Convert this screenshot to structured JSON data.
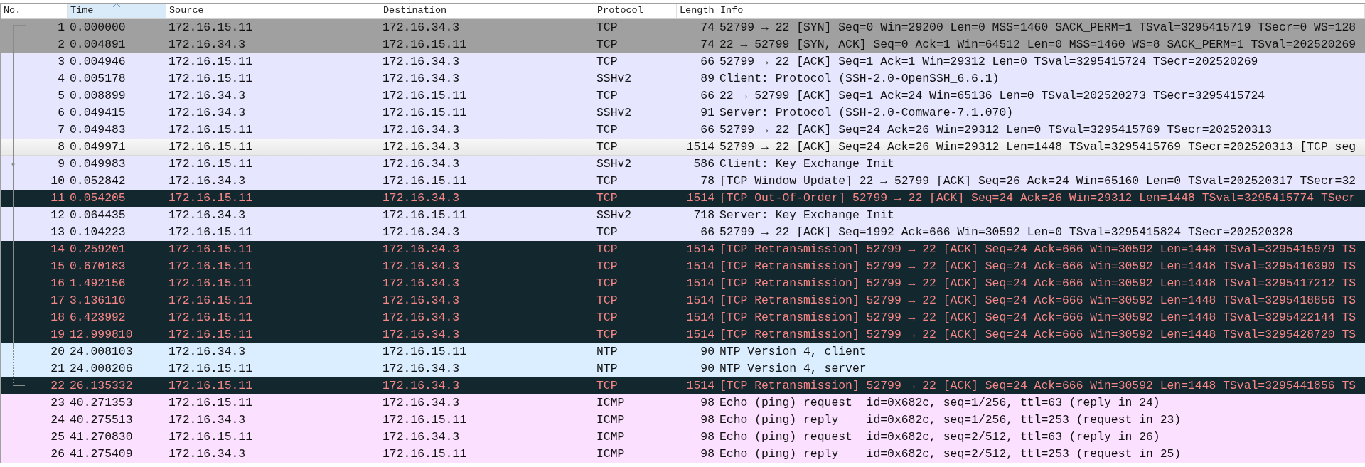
{
  "columns": [
    {
      "label": "No.",
      "sorted": false
    },
    {
      "label": "Time",
      "sorted": true
    },
    {
      "label": "Source",
      "sorted": false
    },
    {
      "label": "Destination",
      "sorted": false
    },
    {
      "label": "Protocol",
      "sorted": false
    },
    {
      "label": "Length",
      "sorted": false
    },
    {
      "label": "Info",
      "sorted": false
    }
  ],
  "rows": [
    {
      "no": "1",
      "time": "0.000000",
      "source": "172.16.15.11",
      "destination": "172.16.34.3",
      "protocol": "TCP",
      "length": "74",
      "info": "52799 → 22 [SYN] Seq=0 Win=29200 Len=0 MSS=1460 SACK_PERM=1 TSval=3295415719 TSecr=0 WS=128",
      "kind": "syn",
      "selected": false
    },
    {
      "no": "2",
      "time": "0.004891",
      "source": "172.16.34.3",
      "destination": "172.16.15.11",
      "protocol": "TCP",
      "length": "74",
      "info": "22 → 52799 [SYN, ACK] Seq=0 Ack=1 Win=64512 Len=0 MSS=1460 WS=8 SACK_PERM=1 TSval=202520269",
      "kind": "syn",
      "selected": false
    },
    {
      "no": "3",
      "time": "0.004946",
      "source": "172.16.15.11",
      "destination": "172.16.34.3",
      "protocol": "TCP",
      "length": "66",
      "info": "52799 → 22 [ACK] Seq=1 Ack=1 Win=29312 Len=0 TSval=3295415724 TSecr=202520269",
      "kind": "tcp",
      "selected": false
    },
    {
      "no": "4",
      "time": "0.005178",
      "source": "172.16.15.11",
      "destination": "172.16.34.3",
      "protocol": "SSHv2",
      "length": "89",
      "info": "Client: Protocol (SSH-2.0-OpenSSH_6.6.1)",
      "kind": "tcp",
      "selected": false
    },
    {
      "no": "5",
      "time": "0.008899",
      "source": "172.16.34.3",
      "destination": "172.16.15.11",
      "protocol": "TCP",
      "length": "66",
      "info": "22 → 52799 [ACK] Seq=1 Ack=24 Win=65136 Len=0 TSval=202520273 TSecr=3295415724",
      "kind": "tcp",
      "selected": false
    },
    {
      "no": "6",
      "time": "0.049415",
      "source": "172.16.34.3",
      "destination": "172.16.15.11",
      "protocol": "SSHv2",
      "length": "91",
      "info": "Server: Protocol (SSH-2.0-Comware-7.1.070)",
      "kind": "tcp",
      "selected": false
    },
    {
      "no": "7",
      "time": "0.049483",
      "source": "172.16.15.11",
      "destination": "172.16.34.3",
      "protocol": "TCP",
      "length": "66",
      "info": "52799 → 22 [ACK] Seq=24 Ack=26 Win=29312 Len=0 TSval=3295415769 TSecr=202520313",
      "kind": "tcp",
      "selected": false
    },
    {
      "no": "8",
      "time": "0.049971",
      "source": "172.16.15.11",
      "destination": "172.16.34.3",
      "protocol": "TCP",
      "length": "1514",
      "info": "52799 → 22 [ACK] Seq=24 Ack=26 Win=29312 Len=1448 TSval=3295415769 TSecr=202520313 [TCP seg",
      "kind": "tcp",
      "selected": true
    },
    {
      "no": "9",
      "time": "0.049983",
      "source": "172.16.15.11",
      "destination": "172.16.34.3",
      "protocol": "SSHv2",
      "length": "586",
      "info": "Client: Key Exchange Init",
      "kind": "tcp",
      "selected": false
    },
    {
      "no": "10",
      "time": "0.052842",
      "source": "172.16.34.3",
      "destination": "172.16.15.11",
      "protocol": "TCP",
      "length": "78",
      "info": "[TCP Window Update] 22 → 52799 [ACK] Seq=26 Ack=24 Win=65160 Len=0 TSval=202520317 TSecr=32",
      "kind": "tcp",
      "selected": false
    },
    {
      "no": "11",
      "time": "0.054205",
      "source": "172.16.15.11",
      "destination": "172.16.34.3",
      "protocol": "TCP",
      "length": "1514",
      "info": "[TCP Out-Of-Order] 52799 → 22 [ACK] Seq=24 Ack=26 Win=29312 Len=1448 TSval=3295415774 TSecr",
      "kind": "bad",
      "selected": false
    },
    {
      "no": "12",
      "time": "0.064435",
      "source": "172.16.34.3",
      "destination": "172.16.15.11",
      "protocol": "SSHv2",
      "length": "718",
      "info": "Server: Key Exchange Init",
      "kind": "tcp",
      "selected": false
    },
    {
      "no": "13",
      "time": "0.104223",
      "source": "172.16.15.11",
      "destination": "172.16.34.3",
      "protocol": "TCP",
      "length": "66",
      "info": "52799 → 22 [ACK] Seq=1992 Ack=666 Win=30592 Len=0 TSval=3295415824 TSecr=202520328",
      "kind": "tcp",
      "selected": false
    },
    {
      "no": "14",
      "time": "0.259201",
      "source": "172.16.15.11",
      "destination": "172.16.34.3",
      "protocol": "TCP",
      "length": "1514",
      "info": "[TCP Retransmission] 52799 → 22 [ACK] Seq=24 Ack=666 Win=30592 Len=1448 TSval=3295415979 TS",
      "kind": "bad",
      "selected": false
    },
    {
      "no": "15",
      "time": "0.670183",
      "source": "172.16.15.11",
      "destination": "172.16.34.3",
      "protocol": "TCP",
      "length": "1514",
      "info": "[TCP Retransmission] 52799 → 22 [ACK] Seq=24 Ack=666 Win=30592 Len=1448 TSval=3295416390 TS",
      "kind": "bad",
      "selected": false
    },
    {
      "no": "16",
      "time": "1.492156",
      "source": "172.16.15.11",
      "destination": "172.16.34.3",
      "protocol": "TCP",
      "length": "1514",
      "info": "[TCP Retransmission] 52799 → 22 [ACK] Seq=24 Ack=666 Win=30592 Len=1448 TSval=3295417212 TS",
      "kind": "bad",
      "selected": false
    },
    {
      "no": "17",
      "time": "3.136110",
      "source": "172.16.15.11",
      "destination": "172.16.34.3",
      "protocol": "TCP",
      "length": "1514",
      "info": "[TCP Retransmission] 52799 → 22 [ACK] Seq=24 Ack=666 Win=30592 Len=1448 TSval=3295418856 TS",
      "kind": "bad",
      "selected": false
    },
    {
      "no": "18",
      "time": "6.423992",
      "source": "172.16.15.11",
      "destination": "172.16.34.3",
      "protocol": "TCP",
      "length": "1514",
      "info": "[TCP Retransmission] 52799 → 22 [ACK] Seq=24 Ack=666 Win=30592 Len=1448 TSval=3295422144 TS",
      "kind": "bad",
      "selected": false
    },
    {
      "no": "19",
      "time": "12.999810",
      "source": "172.16.15.11",
      "destination": "172.16.34.3",
      "protocol": "TCP",
      "length": "1514",
      "info": "[TCP Retransmission] 52799 → 22 [ACK] Seq=24 Ack=666 Win=30592 Len=1448 TSval=3295428720 TS",
      "kind": "bad",
      "selected": false
    },
    {
      "no": "20",
      "time": "24.008103",
      "source": "172.16.34.3",
      "destination": "172.16.15.11",
      "protocol": "NTP",
      "length": "90",
      "info": "NTP Version 4, client",
      "kind": "udp",
      "selected": false
    },
    {
      "no": "21",
      "time": "24.008206",
      "source": "172.16.15.11",
      "destination": "172.16.34.3",
      "protocol": "NTP",
      "length": "90",
      "info": "NTP Version 4, server",
      "kind": "udp",
      "selected": false
    },
    {
      "no": "22",
      "time": "26.135332",
      "source": "172.16.15.11",
      "destination": "172.16.34.3",
      "protocol": "TCP",
      "length": "1514",
      "info": "[TCP Retransmission] 52799 → 22 [ACK] Seq=24 Ack=666 Win=30592 Len=1448 TSval=3295441856 TS",
      "kind": "bad",
      "selected": false
    },
    {
      "no": "23",
      "time": "40.271353",
      "source": "172.16.15.11",
      "destination": "172.16.34.3",
      "protocol": "ICMP",
      "length": "98",
      "info": "Echo (ping) request  id=0x682c, seq=1/256, ttl=63 (reply in 24)",
      "kind": "icmp",
      "selected": false
    },
    {
      "no": "24",
      "time": "40.275513",
      "source": "172.16.34.3",
      "destination": "172.16.15.11",
      "protocol": "ICMP",
      "length": "98",
      "info": "Echo (ping) reply    id=0x682c, seq=1/256, ttl=253 (request in 23)",
      "kind": "icmp",
      "selected": false
    },
    {
      "no": "25",
      "time": "41.270830",
      "source": "172.16.15.11",
      "destination": "172.16.34.3",
      "protocol": "ICMP",
      "length": "98",
      "info": "Echo (ping) request  id=0x682c, seq=2/512, ttl=63 (reply in 26)",
      "kind": "icmp",
      "selected": false
    },
    {
      "no": "26",
      "time": "41.275409",
      "source": "172.16.34.3",
      "destination": "172.16.15.11",
      "protocol": "ICMP",
      "length": "98",
      "info": "Echo (ping) reply    id=0x682c, seq=2/512, ttl=253 (request in 25)",
      "kind": "icmp",
      "selected": false
    }
  ]
}
